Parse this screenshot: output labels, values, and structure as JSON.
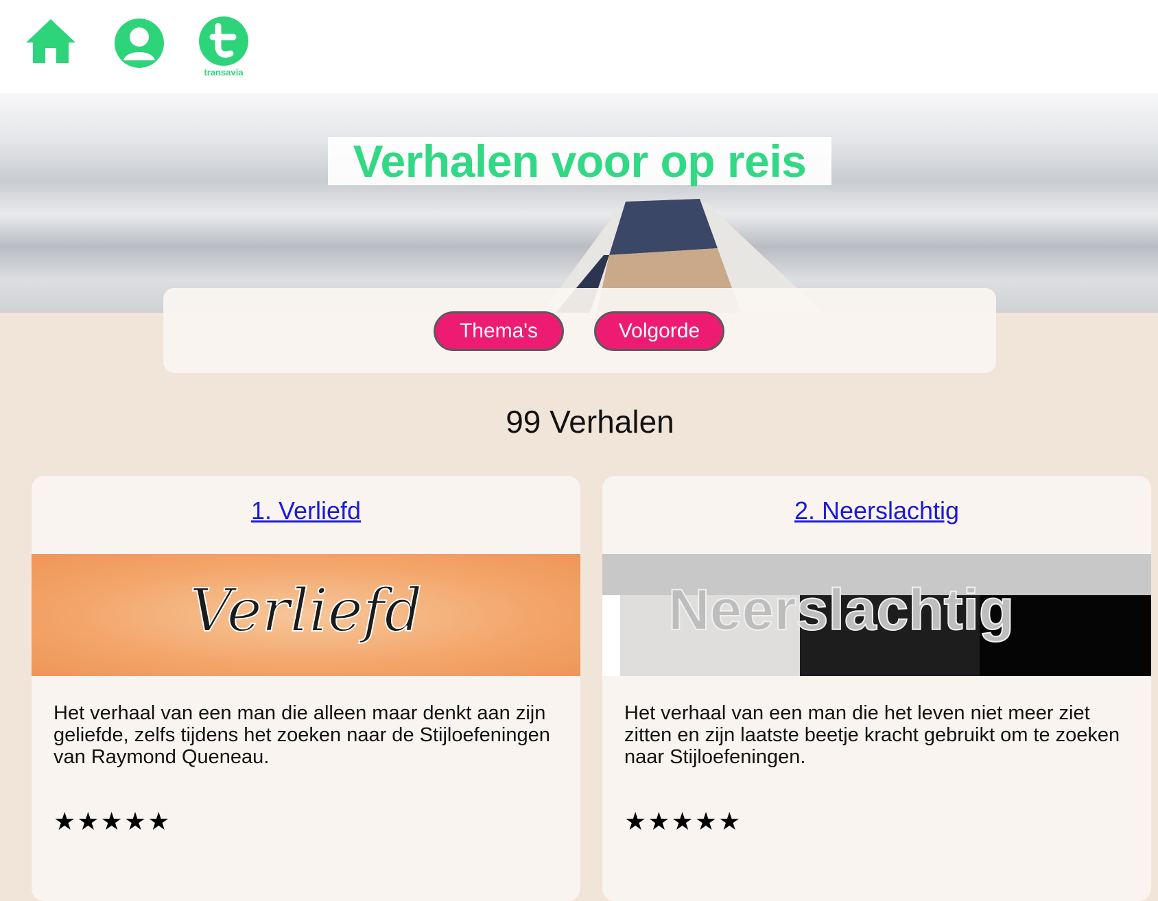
{
  "nav": {
    "home_icon": "home-icon",
    "profile_icon": "user-icon",
    "brand_logo_text": "transavia"
  },
  "hero": {
    "title": "Verhalen voor op reis"
  },
  "filters": {
    "themes_label": "Thema's",
    "order_label": "Volgorde"
  },
  "results": {
    "count_text": "99 Verhalen"
  },
  "cards": [
    {
      "title": "1. Verliefd",
      "image_text": "Verliefd",
      "description": "Het verhaal van een man die alleen maar denkt aan zijn geliefde, zelfs tijdens het zoeken naar de Stijloefeningen van Raymond Queneau.",
      "rating": 5,
      "stars": "★★★★★"
    },
    {
      "title": "2. Neerslachtig",
      "image_text": "Neerslachtig",
      "description": "Het verhaal van een man die het leven niet meer ziet zitten en zijn laatste beetje kracht gebruikt om te zoeken naar Stijloefeningen.",
      "rating": 5,
      "stars": "★★★★★"
    }
  ],
  "colors": {
    "brand_green": "#32d985",
    "pill_pink": "#ee1b72",
    "link_blue": "#1a1adb",
    "page_bg": "#f1e4d9"
  }
}
